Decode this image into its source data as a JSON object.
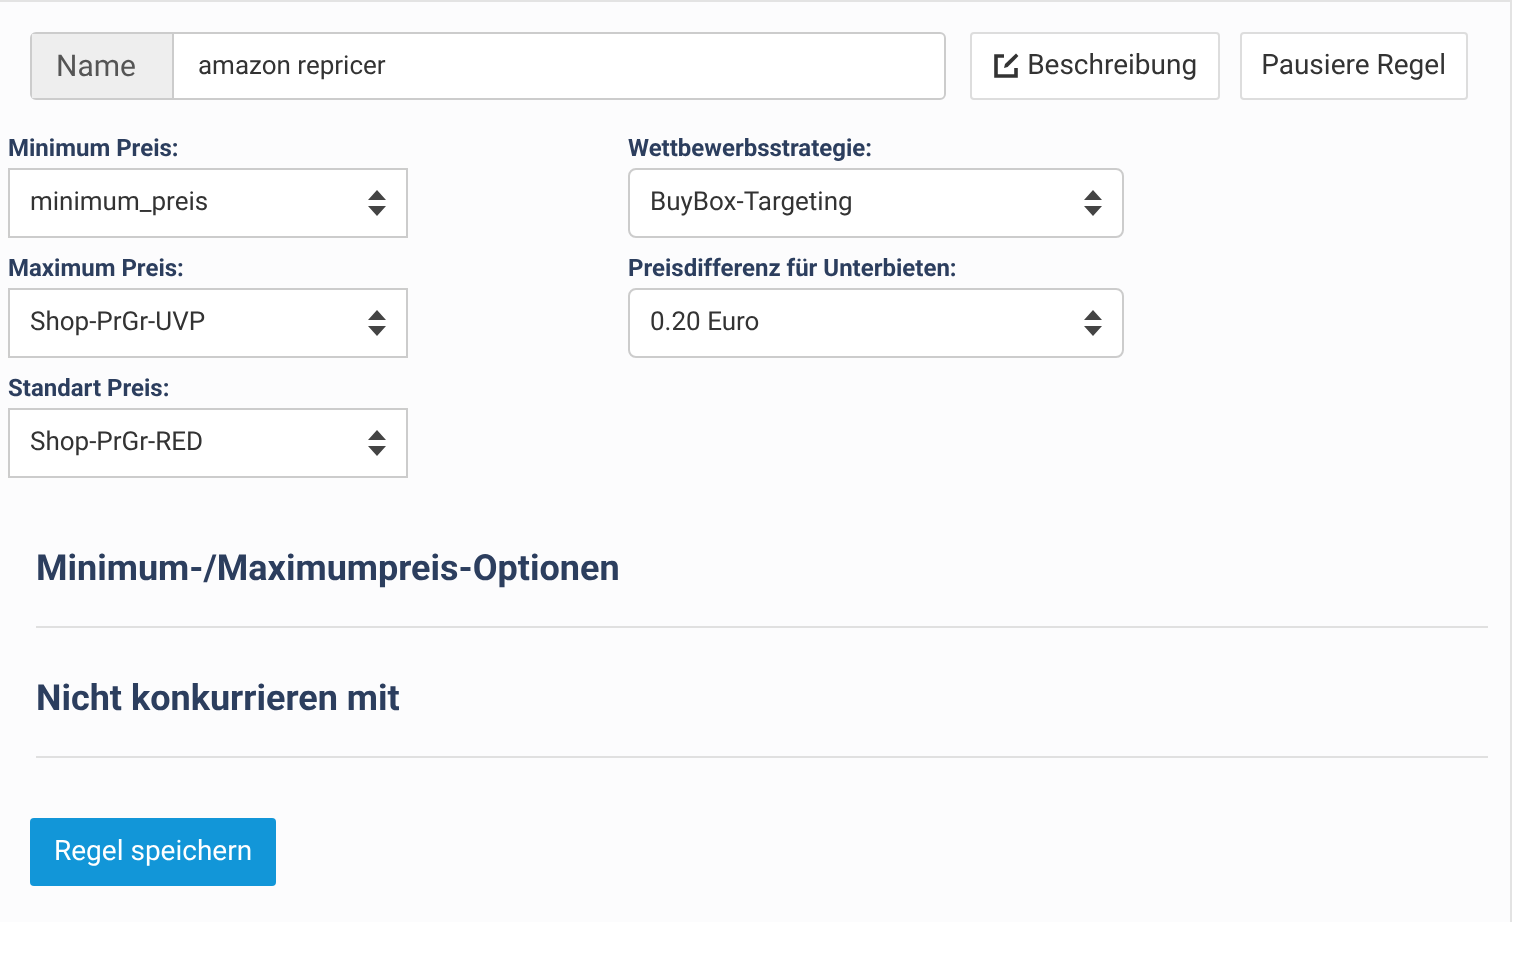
{
  "name_field": {
    "label": "Name",
    "value": "amazon repricer"
  },
  "buttons": [
    {
      "kind": "description",
      "label": "Beschreibung"
    },
    {
      "kind": "plain",
      "label": "Pausiere Regel"
    }
  ],
  "left_selects": [
    {
      "label": "Minimum Preis:",
      "value": "minimum_preis"
    },
    {
      "label": "Maximum Preis:",
      "value": "Shop-PrGr-UVP"
    },
    {
      "label": "Standart Preis:",
      "value": "Shop-PrGr-RED"
    }
  ],
  "right_selects": [
    {
      "label": "Wettbewerbsstrategie:",
      "value": "BuyBox-Targeting"
    },
    {
      "label": "Preisdifferenz für Unterbieten:",
      "value": "0.20 Euro"
    }
  ],
  "sections": [
    "Minimum-/Maximumpreis-Optionen",
    "Nicht konkurrieren mit"
  ],
  "save_button": "Regel speichern"
}
